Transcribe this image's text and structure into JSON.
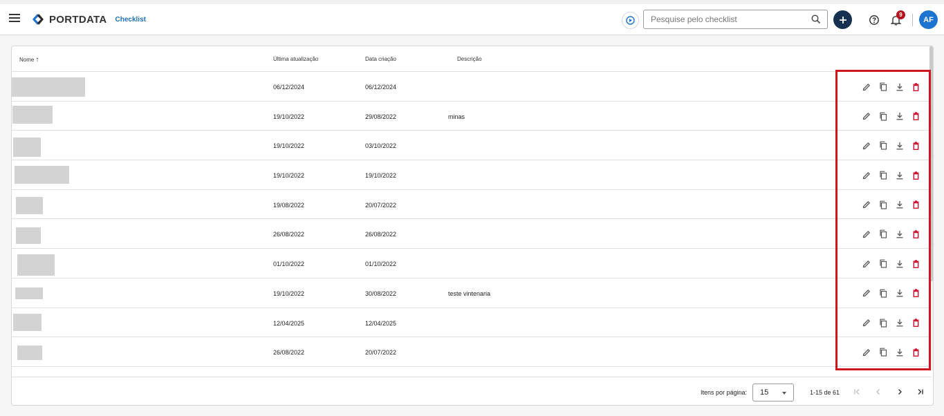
{
  "header": {
    "logo_text": "PORTDATA",
    "section": "Checklist",
    "search_placeholder": "Pesquise pelo checklist",
    "notification_count": "9",
    "avatar_initials": "AF"
  },
  "table": {
    "columns": {
      "name": "Nome",
      "updated": "Última atualização",
      "created": "Data criação",
      "description": "Descrição"
    },
    "rows": [
      {
        "updated": "06/12/2024",
        "created": "06/12/2024",
        "description": ""
      },
      {
        "updated": "19/10/2022",
        "created": "29/08/2022",
        "description": "minas"
      },
      {
        "updated": "19/10/2022",
        "created": "03/10/2022",
        "description": ""
      },
      {
        "updated": "19/10/2022",
        "created": "19/10/2022",
        "description": ""
      },
      {
        "updated": "19/08/2022",
        "created": "20/07/2022",
        "description": ""
      },
      {
        "updated": "26/08/2022",
        "created": "26/08/2022",
        "description": ""
      },
      {
        "updated": "01/10/2022",
        "created": "01/10/2022",
        "description": ""
      },
      {
        "updated": "19/10/2022",
        "created": "30/08/2022",
        "description": "teste vintenaria"
      },
      {
        "updated": "12/04/2025",
        "created": "12/04/2025",
        "description": ""
      },
      {
        "updated": "26/08/2022",
        "created": "20/07/2022",
        "description": ""
      }
    ]
  },
  "footer": {
    "items_per_page_label": "Itens por página:",
    "items_per_page_value": "15",
    "range": "1-15 de 61"
  },
  "colors": {
    "delete": "#c8102e",
    "primary": "#16314f",
    "avatar": "#1d74d0",
    "highlight": "#d0161d"
  }
}
